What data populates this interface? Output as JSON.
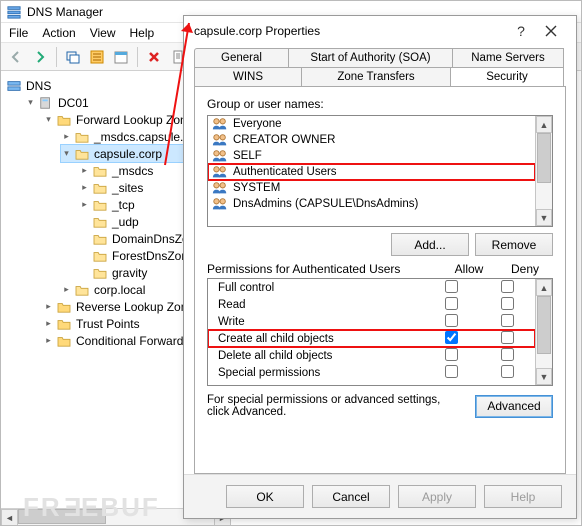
{
  "app": {
    "title": "DNS Manager",
    "menu": {
      "file": "File",
      "action": "Action",
      "view": "View",
      "help": "Help"
    }
  },
  "tree": {
    "root": "DNS",
    "server": "DC01",
    "fwd": "Forward Lookup Zone",
    "zones_child1": "_msdcs.capsule.c",
    "zone_selected": "capsule.corp",
    "sub": {
      "msdcs": "_msdcs",
      "sites": "_sites",
      "tcp": "_tcp",
      "udp": "_udp",
      "ddz": "DomainDnsZo",
      "fdz": "ForestDnsZon",
      "gravity": "gravity"
    },
    "corplocal": "corp.local",
    "rev": "Reverse Lookup Zones",
    "trust": "Trust Points",
    "cond": "Conditional Forwarder"
  },
  "dialog": {
    "title": "capsule.corp Properties",
    "tabs_row1": {
      "general": "General",
      "soa": "Start of Authority (SOA)",
      "ns": "Name Servers"
    },
    "tabs_row2": {
      "wins": "WINS",
      "zt": "Zone Transfers",
      "security": "Security"
    },
    "group_label": "Group or user names:",
    "principals": [
      "Everyone",
      "CREATOR OWNER",
      "SELF",
      "Authenticated Users",
      "SYSTEM",
      "DnsAdmins (CAPSULE\\DnsAdmins)"
    ],
    "add": "Add...",
    "remove": "Remove",
    "perm_heading": "Permissions for Authenticated Users",
    "col_allow": "Allow",
    "col_deny": "Deny",
    "permissions": [
      {
        "name": "Full control",
        "allow": false,
        "deny": false
      },
      {
        "name": "Read",
        "allow": false,
        "deny": false
      },
      {
        "name": "Write",
        "allow": false,
        "deny": false
      },
      {
        "name": "Create all child objects",
        "allow": true,
        "deny": false
      },
      {
        "name": "Delete all child objects",
        "allow": false,
        "deny": false
      },
      {
        "name": "Special permissions",
        "allow": false,
        "deny": false
      }
    ],
    "adv_text": "For special permissions or advanced settings, click Advanced.",
    "advanced": "Advanced",
    "ok": "OK",
    "cancel": "Cancel",
    "apply": "Apply",
    "help": "Help"
  }
}
